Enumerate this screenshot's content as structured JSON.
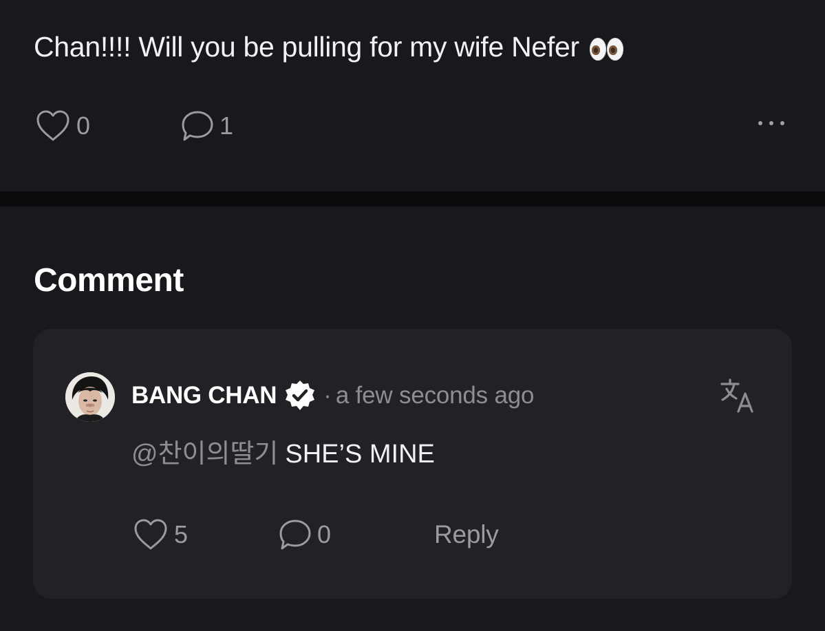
{
  "post": {
    "text": "Chan!!!! Will you be pulling for my wife Nefer",
    "emoji": "eyes",
    "likes": "0",
    "comments": "1"
  },
  "comments_section": {
    "title": "Comment"
  },
  "comment": {
    "author": "BANG CHAN",
    "verified": true,
    "separator": "·",
    "timestamp": "a few seconds ago",
    "mention": "@찬이의딸기",
    "text": "SHE’S MINE",
    "likes": "5",
    "replies": "0",
    "reply_label": "Reply"
  },
  "icons": {
    "like": "heart-outline-icon",
    "comment": "speech-bubble-icon",
    "more": "more-horizontal-icon",
    "verified": "verified-badge-icon",
    "translate": "translate-icon"
  },
  "colors": {
    "background": "#19181d",
    "card": "#222126",
    "divider": "#0c0c0e",
    "text_primary": "#f2f2f4",
    "text_secondary": "#8e8d95"
  }
}
